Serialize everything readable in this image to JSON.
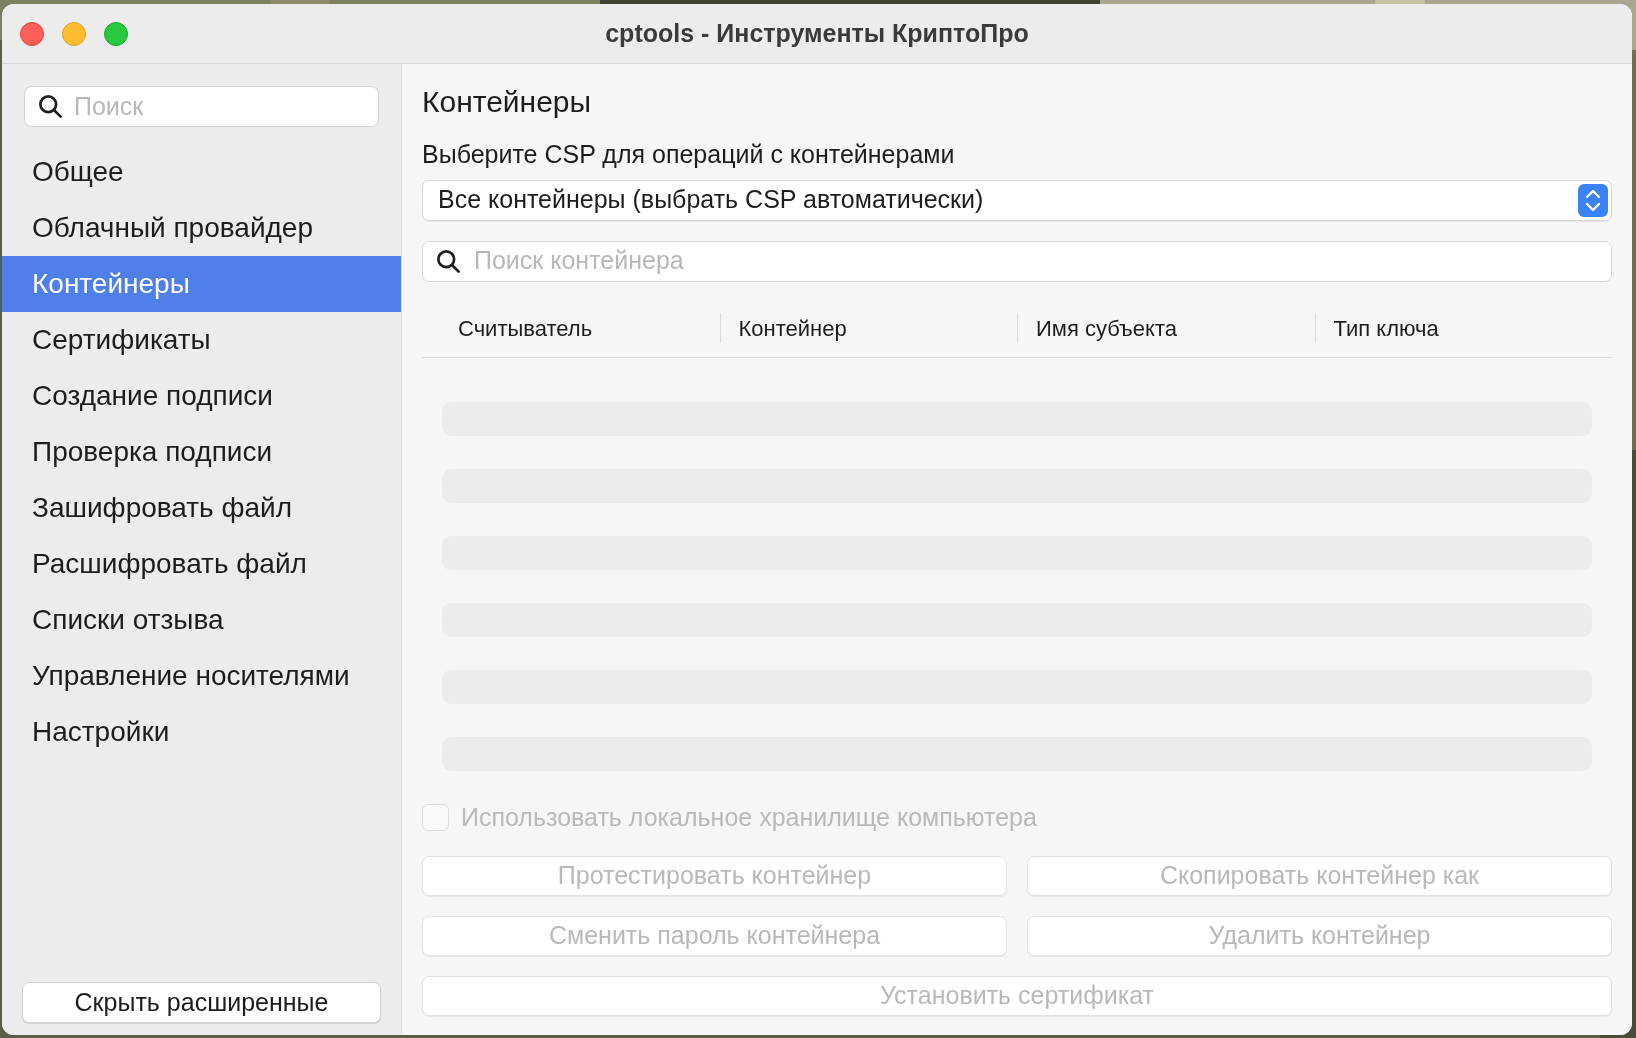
{
  "window": {
    "title": "cptools - Инструменты КриптоПро"
  },
  "sidebar": {
    "search": {
      "placeholder": "Поиск"
    },
    "items": [
      {
        "label": "Общее",
        "selected": false
      },
      {
        "label": "Облачный провайдер",
        "selected": false
      },
      {
        "label": "Контейнеры",
        "selected": true
      },
      {
        "label": "Сертификаты",
        "selected": false
      },
      {
        "label": "Создание подписи",
        "selected": false
      },
      {
        "label": "Проверка подписи",
        "selected": false
      },
      {
        "label": "Зашифровать файл",
        "selected": false
      },
      {
        "label": "Расшифровать файл",
        "selected": false
      },
      {
        "label": "Списки отзыва",
        "selected": false
      },
      {
        "label": "Управление носителями",
        "selected": false
      },
      {
        "label": "Настройки",
        "selected": false
      }
    ],
    "footer_button": {
      "label": "Скрыть расширенные",
      "disabled": false
    }
  },
  "content": {
    "title": "Контейнеры",
    "csp_label": "Выберите CSP для операций с контейнерами",
    "csp_select": {
      "value": "Все контейнеры (выбрать CSP автоматически)"
    },
    "search": {
      "placeholder": "Поиск контейнера"
    },
    "table": {
      "columns": [
        "Считыватель",
        "Контейнер",
        "Имя субъекта",
        "Тип ключа"
      ]
    },
    "checkbox": {
      "label": "Использовать локальное хранилище компьютера",
      "checked": false,
      "disabled": true
    },
    "buttons": [
      {
        "label": "Протестировать контейнер",
        "disabled": true
      },
      {
        "label": "Скопировать контейнер как",
        "disabled": true
      },
      {
        "label": "Сменить пароль контейнера",
        "disabled": true
      },
      {
        "label": "Удалить контейнер",
        "disabled": true
      },
      {
        "label": "Установить сертификат",
        "disabled": true,
        "wide": true
      }
    ]
  }
}
